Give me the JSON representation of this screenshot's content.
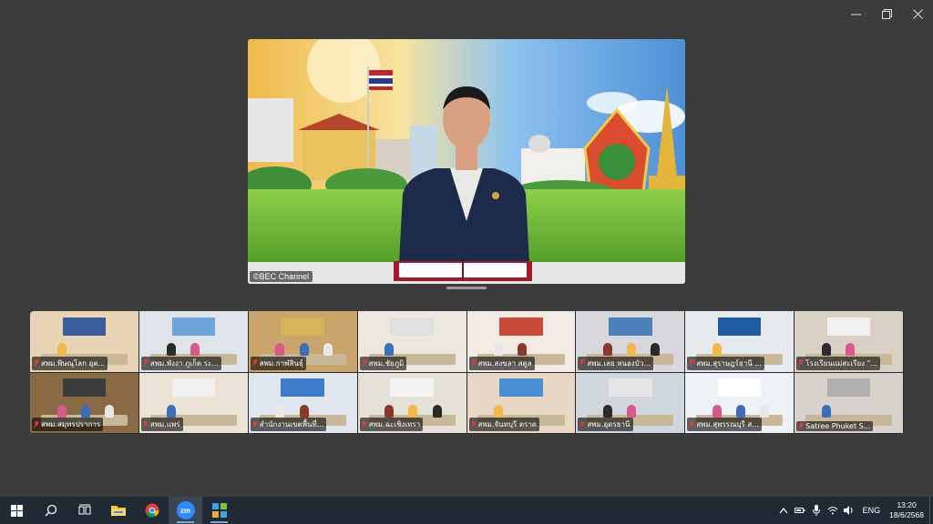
{
  "window": {
    "controls": [
      "minimize",
      "restore",
      "close"
    ]
  },
  "speaker": {
    "label": "©BEC Channel"
  },
  "gallery": {
    "tiles": [
      {
        "name": "สพม.พิษณุโลก อุต..."
      },
      {
        "name": "สพม.พังงา ภูเก็ต ระ..."
      },
      {
        "name": "สพม.กาฬสินธุ์"
      },
      {
        "name": "สพม.ชัยภูมิ"
      },
      {
        "name": "สพม.สงขลา สตูล"
      },
      {
        "name": "สพม.เลย หนองบัว..."
      },
      {
        "name": "สพม.สุราษฎร์ธานี ..."
      },
      {
        "name": "โรงเรียนแม่สะเรียง \"..."
      },
      {
        "name": "สพม.สมุทรปราการ"
      },
      {
        "name": "สพม.แพร่"
      },
      {
        "name": "สำนักงานเขตพื้นที่..."
      },
      {
        "name": "สพม.ฉะเชิงเทรา"
      },
      {
        "name": "สพม.จันทบุรี ตราด"
      },
      {
        "name": "สพม.อุดรธานี"
      },
      {
        "name": "สพม.สุพรรณบุรี ส..."
      },
      {
        "name": "Satree Phuket S..."
      }
    ]
  },
  "taskbar": {
    "apps": [
      "start",
      "search",
      "task-view",
      "file-explorer",
      "chrome",
      "zoom",
      "app-grid"
    ],
    "zoom_label": "zm",
    "language": "ENG",
    "time": "13:20",
    "date": "18/6/2568"
  },
  "colors": {
    "background": "#3c3c3c",
    "taskbar": "#1f2a35",
    "zoom_accent": "#2d8cff"
  }
}
